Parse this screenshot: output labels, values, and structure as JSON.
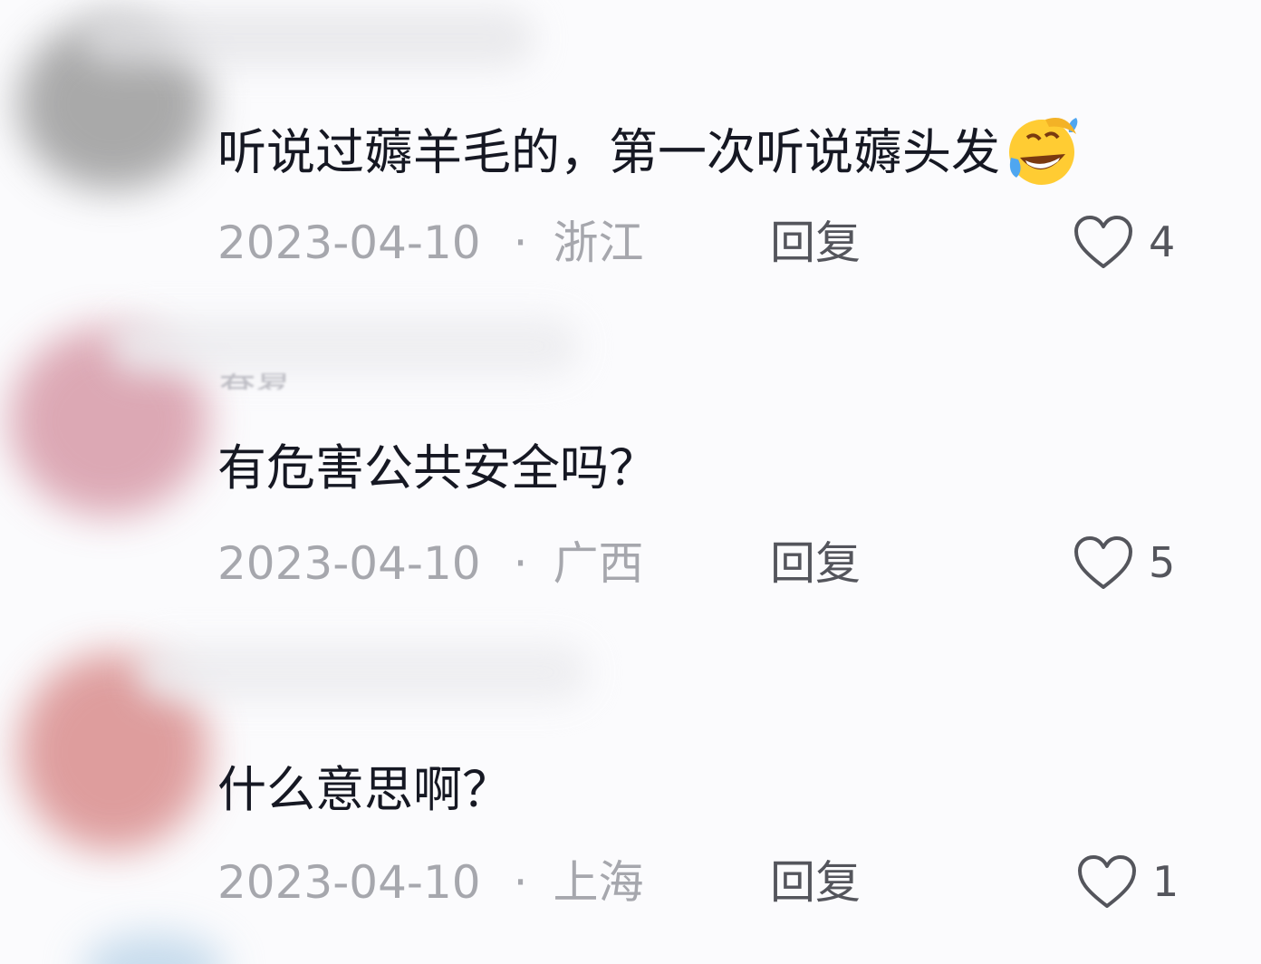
{
  "comments": [
    {
      "text": "听说过薅羊毛的，第一次听说薅头发",
      "emoji": "rofl-emoji",
      "date": "2023-04-10",
      "location": "浙江",
      "reply_label": "回复",
      "likes": "4"
    },
    {
      "text": "有危害公共安全吗？",
      "date": "2023-04-10",
      "location": "广西",
      "reply_label": "回复",
      "likes": "5"
    },
    {
      "text": "什么意思啊？",
      "date": "2023-04-10",
      "location": "上海",
      "reply_label": "回复",
      "likes": "1"
    }
  ],
  "separator": "·",
  "icons": {
    "like": "heart-outline-icon"
  },
  "colors": {
    "text": "#161823",
    "meta": "#a6a7ad",
    "reply": "#54555c",
    "background": "#fbfbfd"
  }
}
